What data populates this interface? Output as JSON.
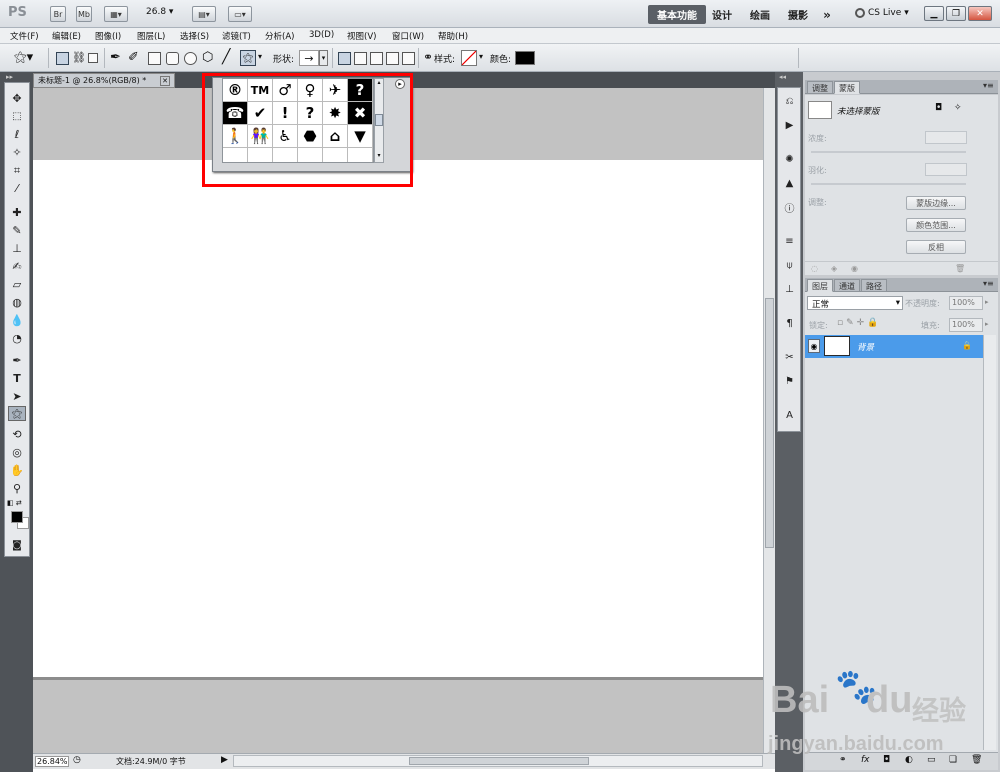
{
  "app": {
    "logo": "PS",
    "quick_buttons": [
      "Br",
      "Mb"
    ],
    "zoom_dropdown": "26.8",
    "workspaces": [
      "基本功能",
      "设计",
      "绘画",
      "摄影"
    ],
    "more": "»",
    "cs_live": "CS Live"
  },
  "menu": [
    "文件(F)",
    "编辑(E)",
    "图像(I)",
    "图层(L)",
    "选择(S)",
    "滤镜(T)",
    "分析(A)",
    "3D(D)",
    "视图(V)",
    "窗口(W)",
    "帮助(H)"
  ],
  "options": {
    "shape_label": "形状:",
    "style_label": "样式:",
    "color_label": "颜色:",
    "color_value": "#000000"
  },
  "document": {
    "tab_title": "未标题-1 @ 26.8%(RGB/8) *",
    "tab_close": "✕"
  },
  "shape_picker": {
    "shapes": [
      "®",
      "TM",
      "♂",
      "♀",
      "✈",
      "?",
      "☎",
      "✔",
      "!",
      "?",
      "✸",
      "✖",
      "🚶",
      "👫",
      "♿",
      "⬣",
      "⌂",
      "▼",
      "",
      "",
      "",
      "",
      "",
      ""
    ],
    "menu_icon": "▸"
  },
  "mask_panel": {
    "tabs": [
      "调整",
      "蒙版"
    ],
    "title": "未选择蒙版",
    "density_label": "浓度:",
    "feather_label": "羽化:",
    "refine_label": "调整:",
    "buttons": [
      "蒙版边缘...",
      "颜色范围...",
      "反相"
    ]
  },
  "layers_panel": {
    "tabs": [
      "图层",
      "通道",
      "路径"
    ],
    "blend_mode": "正常",
    "opacity_label": "不透明度:",
    "opacity_value": "100%",
    "lock_label": "锁定:",
    "fill_label": "填充:",
    "fill_value": "100%",
    "layer_name": "背景"
  },
  "status": {
    "zoom": "26.84%",
    "doc_info": "文档:24.9M/0 字节"
  },
  "watermark": {
    "brand": "Bai",
    "brand2": "du",
    "cn": "经验",
    "url": "jingyan.baidu.com"
  },
  "colors": {
    "accent": "#4b9bea",
    "highlight_box": "#ff0000",
    "foreground": "#000000",
    "background": "#ffffff"
  }
}
